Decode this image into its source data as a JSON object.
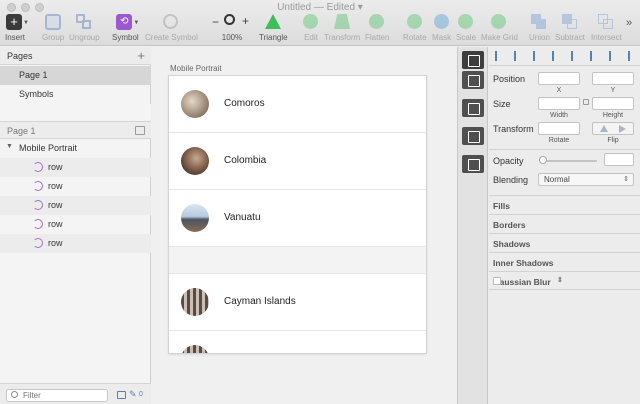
{
  "window": {
    "title": "Untitled",
    "edited": "— Edited ▾"
  },
  "toolbar": {
    "insert": "Insert",
    "group": "Group",
    "ungroup": "Ungroup",
    "symbol": "Symbol",
    "create_symbol": "Create Symbol",
    "zoom": "100%",
    "triangle": "Triangle",
    "edit": "Edit",
    "transform": "Transform",
    "flatten": "Flatten",
    "rotate": "Rotate",
    "mask": "Mask",
    "scale": "Scale",
    "make_grid": "Make Grid",
    "union": "Union",
    "subtract": "Subtract",
    "intersect": "Intersect",
    "more": "»"
  },
  "pages": {
    "header": "Pages",
    "add": "+",
    "items": [
      {
        "label": "Page 1"
      },
      {
        "label": "Symbols"
      }
    ]
  },
  "layers": {
    "page_label": "Page 1",
    "artboard": "Mobile Portrait",
    "items": [
      {
        "label": "row"
      },
      {
        "label": "row"
      },
      {
        "label": "row"
      },
      {
        "label": "row"
      },
      {
        "label": "row"
      }
    ]
  },
  "filter": {
    "placeholder": "Filter",
    "badge": "0"
  },
  "canvas": {
    "artboard_label": "Mobile Portrait",
    "rows": [
      {
        "name": "Comoros"
      },
      {
        "name": "Colombia"
      },
      {
        "name": "Vanuatu"
      },
      {
        "name": "Cayman Islands"
      }
    ]
  },
  "inspector": {
    "position": "Position",
    "x": "X",
    "y": "Y",
    "size": "Size",
    "width": "Width",
    "height": "Height",
    "transform": "Transform",
    "rotate": "Rotate",
    "flip": "Flip",
    "opacity": "Opacity",
    "blending": "Blending",
    "blending_value": "Normal",
    "sections": [
      "Fills",
      "Borders",
      "Shadows",
      "Inner Shadows",
      "Gaussian Blur"
    ]
  },
  "colors": {
    "symbol": "#9b59d0",
    "accent": "#5a7fb8"
  }
}
